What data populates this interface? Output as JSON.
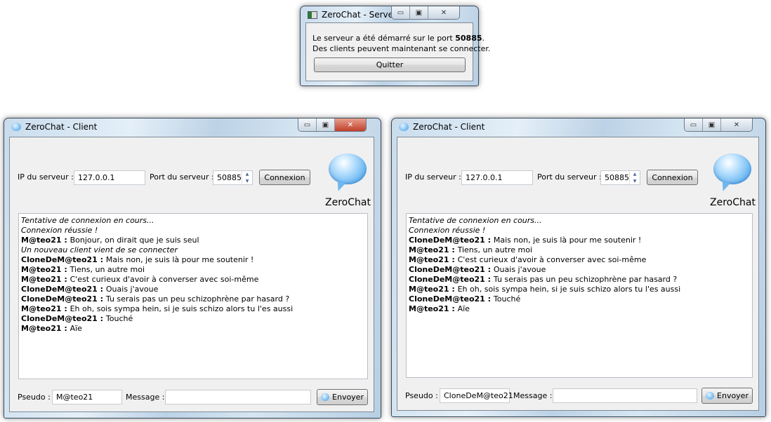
{
  "server": {
    "title": "ZeroChat - Serveur",
    "line1_prefix": "Le serveur a été démarré sur le port ",
    "port": "50885",
    "line1_suffix": ".",
    "line2": "Des clients peuvent maintenant se connecter.",
    "quit_label": "Quitter"
  },
  "clients": [
    {
      "title": "ZeroChat - Client",
      "ip_label": "IP du serveur :",
      "ip": "127.0.0.1",
      "port_label": "Port du serveur :",
      "port": "50885",
      "connect_label": "Connexion",
      "brand": "ZeroChat",
      "pseudo_label": "Pseudo :",
      "pseudo": "M@teo21",
      "message_label": "Message :",
      "message": "",
      "send_label": "Envoyer",
      "messages": [
        {
          "type": "info",
          "text": "Tentative de connexion en cours..."
        },
        {
          "type": "info",
          "text": "Connexion réussie !"
        },
        {
          "type": "msg",
          "author": "M@teo21",
          "text": "Bonjour, on dirait que je suis seul"
        },
        {
          "type": "info",
          "text": "Un nouveau client vient de se connecter"
        },
        {
          "type": "msg",
          "author": "CloneDeM@teo21",
          "text": "Mais non, je suis là pour me soutenir !"
        },
        {
          "type": "msg",
          "author": "M@teo21",
          "text": "Tiens, un autre moi"
        },
        {
          "type": "msg",
          "author": "M@teo21",
          "text": "C'est curieux d'avoir à converser avec soi-même"
        },
        {
          "type": "msg",
          "author": "CloneDeM@teo21",
          "text": "Ouais j'avoue"
        },
        {
          "type": "msg",
          "author": "CloneDeM@teo21",
          "text": "Tu serais pas un peu schizophrène par hasard ?"
        },
        {
          "type": "msg",
          "author": "M@teo21",
          "text": "Eh oh, sois sympa hein, si je suis schizo alors tu l'es aussi"
        },
        {
          "type": "msg",
          "author": "CloneDeM@teo21",
          "text": "Touché"
        },
        {
          "type": "msg",
          "author": "M@teo21",
          "text": "Aïe"
        }
      ]
    },
    {
      "title": "ZeroChat - Client",
      "ip_label": "IP du serveur :",
      "ip": "127.0.0.1",
      "port_label": "Port du serveur :",
      "port": "50885",
      "connect_label": "Connexion",
      "brand": "ZeroChat",
      "pseudo_label": "Pseudo :",
      "pseudo": "CloneDeM@teo21",
      "message_label": "Message :",
      "message": "",
      "send_label": "Envoyer",
      "messages": [
        {
          "type": "info",
          "text": "Tentative de connexion en cours..."
        },
        {
          "type": "info",
          "text": "Connexion réussie !"
        },
        {
          "type": "msg",
          "author": "CloneDeM@teo21",
          "text": "Mais non, je suis là pour me soutenir !"
        },
        {
          "type": "msg",
          "author": "M@teo21",
          "text": "Tiens, un autre moi"
        },
        {
          "type": "msg",
          "author": "M@teo21",
          "text": "C'est curieux d'avoir à converser avec soi-même"
        },
        {
          "type": "msg",
          "author": "CloneDeM@teo21",
          "text": "Ouais j'avoue"
        },
        {
          "type": "msg",
          "author": "CloneDeM@teo21",
          "text": "Tu serais pas un peu schizophrène par hasard ?"
        },
        {
          "type": "msg",
          "author": "M@teo21",
          "text": "Eh oh, sois sympa hein, si je suis schizo alors tu l'es aussi"
        },
        {
          "type": "msg",
          "author": "CloneDeM@teo21",
          "text": "Touché"
        },
        {
          "type": "msg",
          "author": "M@teo21",
          "text": "Aïe"
        }
      ]
    }
  ]
}
